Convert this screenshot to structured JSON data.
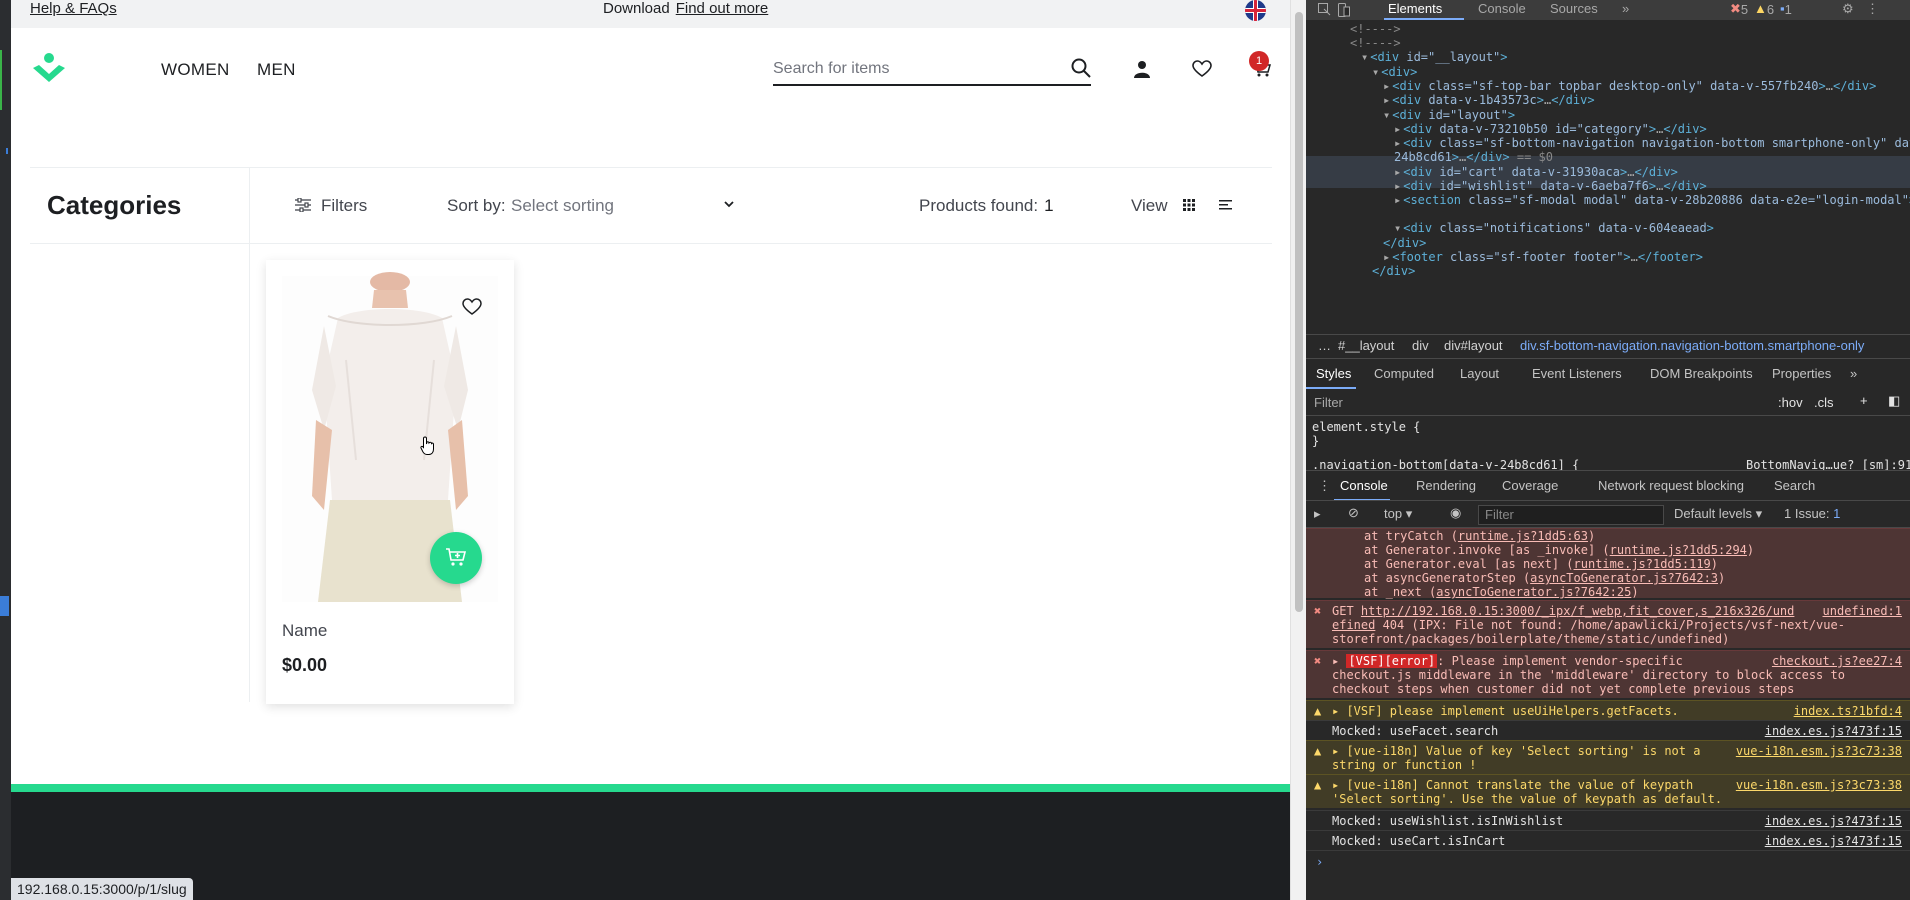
{
  "topbar": {
    "help_link": "Help & FAQs",
    "download_text": "Download",
    "find_out_more": "Find out more"
  },
  "header": {
    "nav": [
      "WOMEN",
      "MEN"
    ],
    "search_placeholder": "Search for items",
    "cart_count": "1"
  },
  "toolbar": {
    "categories_title": "Categories",
    "filters_label": "Filters",
    "sort_label": "Sort by:",
    "sort_placeholder": "Select sorting",
    "products_found_label": "Products found:",
    "products_found_count": "1",
    "view_label": "View"
  },
  "product": {
    "name": "Name",
    "price": "$0.00"
  },
  "status_url": "192.168.0.15:3000/p/1/slug",
  "colors": {
    "brand_green": "#26d98e",
    "badge_red": "#d12727",
    "footer_dark": "#1d1f22"
  },
  "devtools": {
    "tabs": [
      "Elements",
      "Console",
      "Sources"
    ],
    "badges": {
      "errors": "5",
      "warnings": "6",
      "info": "1"
    },
    "dom_lines": [
      {
        "indent": 0,
        "text": "<!---->"
      },
      {
        "indent": 0,
        "text": "<!---->"
      },
      {
        "indent": 1,
        "tag": "div",
        "attrs": "id=\"__layout\""
      },
      {
        "indent": 2,
        "tag": "div",
        "attrs": ""
      },
      {
        "indent": 3,
        "tag": "div",
        "attrs": "class=\"sf-top-bar topbar desktop-only\" data-v-557fb240",
        "collapsed": true
      },
      {
        "indent": 3,
        "tag": "div",
        "attrs": "data-v-1b43573c",
        "collapsed": true
      },
      {
        "indent": 3,
        "tag": "div",
        "attrs": "id=\"layout\""
      },
      {
        "indent": 4,
        "tag": "div",
        "attrs": "data-v-73210b50 id=\"category\"",
        "collapsed": true
      },
      {
        "indent": 4,
        "tag": "div",
        "attrs": "class=\"sf-bottom-navigation navigation-bottom smartphone-only\" data-v-24b8cd61",
        "collapsed": true,
        "selected": true
      },
      {
        "indent": 4,
        "tag": "div",
        "attrs": "id=\"cart\" data-v-31930aca",
        "collapsed": true
      },
      {
        "indent": 4,
        "tag": "div",
        "attrs": "id=\"wishlist\" data-v-6aeba7f6",
        "collapsed": true
      },
      {
        "indent": 4,
        "tag": "section",
        "attrs": "class=\"sf-modal modal\" data-v-28b20886 data-e2e=\"login-modal\"",
        "collapsed": true
      },
      {
        "indent": 4,
        "tag": "div",
        "attrs": "class=\"notifications\" data-v-604eaead"
      },
      {
        "indent": 3,
        "text": "</div>"
      },
      {
        "indent": 3,
        "tag": "footer",
        "attrs": "class=\"sf-footer footer\"",
        "collapsed": true
      },
      {
        "indent": 2,
        "text": "</div>"
      }
    ],
    "selected_suffix": "== $0",
    "breadcrumbs": [
      "#__layout",
      "div",
      "div#layout",
      "div.sf-bottom-navigation.navigation-bottom.smartphone-only"
    ],
    "styles_tabs": [
      "Styles",
      "Computed",
      "Layout",
      "Event Listeners",
      "DOM Breakpoints",
      "Properties"
    ],
    "styles_filter": "Filter",
    "styles_hov": ":hov",
    "styles_cls": ".cls",
    "element_style": "element.style {",
    "element_style_close": "}",
    "rule_selector": ".navigation-bottom[data-v-24b8cd61] {",
    "rule_source": "BottomNavig…ue?_[sm]:91",
    "console_tabs": [
      "Console",
      "Rendering",
      "Coverage",
      "Network request blocking",
      "Search"
    ],
    "console_context": "top",
    "console_filter": "Filter",
    "console_levels": "Default levels",
    "console_issues": "1 Issue:",
    "console_issues_count": "1",
    "stack_lines": [
      {
        "prefix": "at tryCatch (",
        "link": "runtime.js?1dd5:63",
        "suffix": ")"
      },
      {
        "prefix": "at Generator.invoke [as _invoke] (",
        "link": "runtime.js?1dd5:294",
        "suffix": ")"
      },
      {
        "prefix": "at Generator.eval [as next] (",
        "link": "runtime.js?1dd5:119",
        "suffix": ")"
      },
      {
        "prefix": "at asyncGeneratorStep (",
        "link": "asyncToGenerator.js?7642:3",
        "suffix": ")"
      },
      {
        "prefix": "at _next (",
        "link": "asyncToGenerator.js?7642:25",
        "suffix": ")"
      }
    ],
    "get_error": {
      "prefix": "GET ",
      "url": "http://192.168.0.15:3000/_ipx/f_webp,fit_cover,s_216x326/und",
      "src": "undefined:1",
      "line2_link": "efined",
      "line2": " 404 (IPX: File not found: /home/apawlicki/Projects/vsf-next/vue-",
      "line3": "storefront/packages/boilerplate/theme/static/undefined)"
    },
    "vsf_error": {
      "tag": "[VSF][error]",
      "text": ": Please implement vendor-specific",
      "src": "checkout.js?ee27:4",
      "line2": "checkout.js middleware in the 'middleware' directory to block access to",
      "line3": "checkout steps when customer did not yet complete previous steps"
    },
    "warn_facets": {
      "text": "[VSF] please implement useUiHelpers.getFacets.",
      "src": "index.ts?1bfd:4"
    },
    "log_facet": {
      "text": "Mocked: useFacet.search",
      "src": "index.es.js?473f:15"
    },
    "warn_i18n1": {
      "line1": "[vue-i18n] Value of key 'Select sorting' is not a",
      "line2": "string or function !",
      "src": "vue-i18n.esm.js?3c73:38"
    },
    "warn_i18n2": {
      "line1": "[vue-i18n] Cannot translate the value of keypath",
      "line2": "'Select sorting'. Use the value of keypath as default.",
      "src": "vue-i18n.esm.js?3c73:38"
    },
    "log_wishlist": {
      "text": "Mocked: useWishlist.isInWishlist",
      "src": "index.es.js?473f:15"
    },
    "log_cart": {
      "text": "Mocked: useCart.isInCart",
      "src": "index.es.js?473f:15"
    }
  }
}
